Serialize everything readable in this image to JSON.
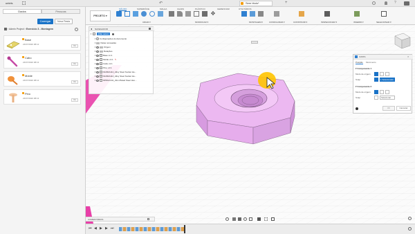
{
  "titlebar": {
    "user": "ueiels"
  },
  "left_panel": {
    "tabs": [
      "Dados",
      "Pessoas"
    ],
    "buttons": {
      "upload": "Carregar",
      "new_folder": "Nova Pasta"
    },
    "breadcrumb": [
      "Admin Project",
      "Exercicio 3 - Montagem"
    ],
    "files": [
      {
        "name": "Base",
        "date": "24/07/2020 08:12",
        "version": "V1"
      },
      {
        "name": "Cabo",
        "date": "24/07/2020 08:13",
        "version": "V1"
      },
      {
        "name": "Molde",
        "date": "24/07/2020 08:12",
        "version": "V1"
      },
      {
        "name": "Pino",
        "date": "24/07/2020 08:13",
        "version": "V1"
      }
    ]
  },
  "appbar": {
    "doc_tab": "Sem título*",
    "workspace": "PROJETO",
    "toolbar_tabs": [
      "SÓLIDO",
      "SUPERFÍCIE",
      "MALHA",
      "CHAPA",
      "PLÁSTICO",
      "GERENCIAR",
      "UTILITÁRIOS"
    ],
    "groups": [
      "CRIAR",
      "MODIFICAR",
      "MONTAGEM",
      "CONFIGURAR",
      "CONSTRUIR",
      "INSPECIONAR",
      "INSERIR",
      "SELECIONAR"
    ]
  },
  "browser": {
    "title": "NAVEGADOR",
    "root": "(Não salvo)",
    "items": [
      {
        "label": "Configurações do documento",
        "kind": "gear"
      },
      {
        "label": "Vistas nomeadas",
        "kind": "folder"
      },
      {
        "label": "Origem",
        "kind": "folder"
      },
      {
        "label": "Relações",
        "kind": "folder"
      },
      {
        "label": "Base v1:1",
        "kind": "component"
      },
      {
        "label": "Molde v1:1",
        "kind": "component"
      },
      {
        "label": "Cabo v1:1",
        "kind": "component"
      },
      {
        "label": "Pino v1:1",
        "kind": "component"
      },
      {
        "label": "91290A114_Alloy Steel Socket He...",
        "kind": "component"
      },
      {
        "label": "91290A114_Alloy Steel Socket He...",
        "kind": "component"
      },
      {
        "label": "90591A141_Zinc-Plated Steel Hex...",
        "kind": "component"
      }
    ]
  },
  "joint_dialog": {
    "title": "JUNTA",
    "tabs": [
      "Posição",
      "Movimento"
    ],
    "component1": "Componente 1",
    "component2": "Componente 2",
    "origin_mode": "Modo de origem",
    "snap": "Snap",
    "snap1_value": "1 Selecionado",
    "snap2_value": "Selecionar",
    "ok": "OK",
    "cancel": "Cancelar"
  },
  "comments": {
    "label": "COMENTÁRIOS"
  },
  "colors": {
    "accent": "#1a73c7",
    "nut": "#e7b8ef",
    "pink": "#e83fa8",
    "highlight": "#ffc400"
  }
}
